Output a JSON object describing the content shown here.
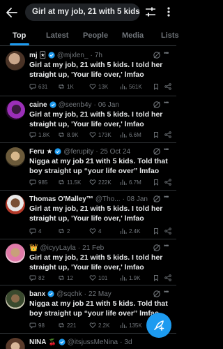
{
  "search": {
    "query": "Girl at my job, 21 with 5 kids. I told her straight up, 'Your life over,' lmfao"
  },
  "tabs": [
    {
      "label": "Top",
      "active": true
    },
    {
      "label": "Latest",
      "active": false
    },
    {
      "label": "People",
      "active": false
    },
    {
      "label": "Media",
      "active": false
    },
    {
      "label": "Lists",
      "active": false
    }
  ],
  "colors": {
    "accent": "#1d9bf0",
    "verified": "#1d9bf0",
    "gold_badge": "#e8b931",
    "muted": "#71767b",
    "background": "#000000"
  },
  "tweets": [
    {
      "name": "mj",
      "name_emoji": "🃏",
      "verified": true,
      "handle": "@mjxlen_",
      "time": "7h",
      "text": "Girl at my job, 21 with 5 kids. I told her straight up, 'Your life over,' lmfao",
      "replies": "631",
      "retweets": "1K",
      "likes": "13K",
      "views": "561K"
    },
    {
      "name": "caine",
      "name_emoji": "",
      "verified": true,
      "handle": "@seenb4y",
      "time": "06 Jan",
      "text": "Girl at my job, 21 with 5 kids. I told her straight up, 'Your life over,' lmfao",
      "replies": "1.8K",
      "retweets": "8.9K",
      "likes": "173K",
      "views": "6.6M"
    },
    {
      "name": "Feru ★",
      "name_emoji": "",
      "verified": true,
      "handle": "@ferupity",
      "time": "25 Oct 24",
      "text": "Nigga at my job 21 with 5 kids. Told that boy straight up “your life over” lmfao",
      "replies": "985",
      "retweets": "11.5K",
      "likes": "222K",
      "views": "6.7M"
    },
    {
      "name": "Thomas O'Malley™",
      "name_emoji": "",
      "verified": false,
      "handle": "@Tho...",
      "time": "08 Jan",
      "text": "Girl at my job, 21 with 5 kids. I told her straight up, 'Your life over,' lmfao",
      "replies": "4",
      "retweets": "2",
      "likes": "4",
      "views": "2.4K"
    },
    {
      "name": "👑",
      "name_emoji": "",
      "verified": false,
      "handle": "@icyyLayla",
      "time": "21 Feb",
      "text": "Girl at my job, 21 with 5 kids. I told her straight up, 'Your life over,' lmfao",
      "replies": "82",
      "retweets": "12",
      "likes": "101",
      "views": "1.9K"
    },
    {
      "name": "banx",
      "name_emoji": "",
      "verified": true,
      "handle": "@sqchk",
      "time": "22 May",
      "text": "Nigga at my job 21 with 5 kids. Told that boy straight up “your life over” lmfao",
      "replies": "98",
      "retweets": "221",
      "likes": "2.2K",
      "views": "135K"
    },
    {
      "name": "NINA",
      "name_emoji": "🍒",
      "verified": true,
      "handle": "@itsjussMeNina",
      "time": "3d",
      "text": "",
      "replies": "",
      "retweets": "",
      "likes": "",
      "views": ""
    }
  ]
}
